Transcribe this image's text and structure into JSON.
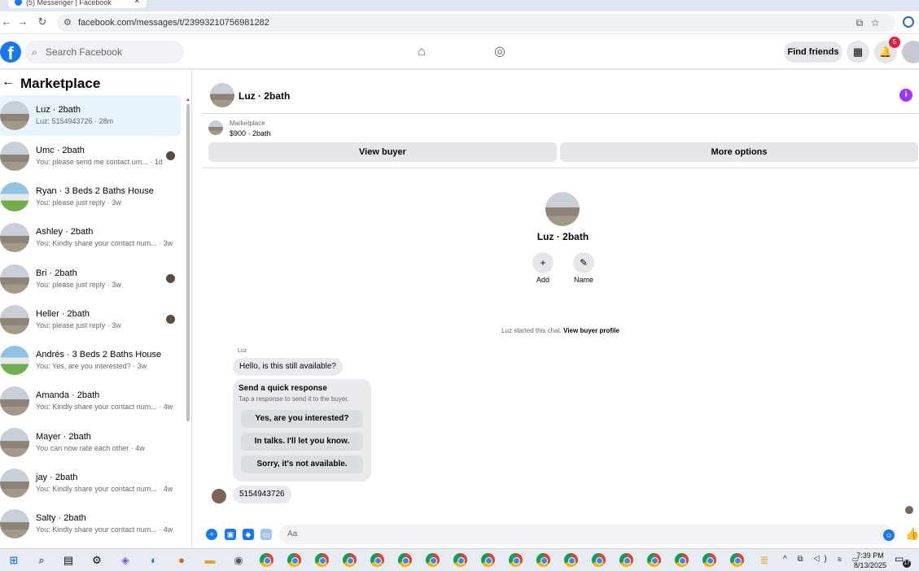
{
  "browser": {
    "tab_title": "(5) Messenger | Facebook",
    "url": "facebook.com/messages/t/23993210756981282"
  },
  "fb_header": {
    "search_placeholder": "Search Facebook",
    "find_friends": "Find friends",
    "notification_count": "5"
  },
  "sidebar": {
    "back_icon": "arrow-left-icon",
    "title": "Marketplace",
    "conversations": [
      {
        "name": "Luz · 2bath",
        "snippet": "Luz: 5154943726 · 28m"
      },
      {
        "name": "Umc · 2bath",
        "snippet": "You: please send me contact um... · 1d"
      },
      {
        "name": "Ryan · 3 Beds 2 Baths House",
        "snippet": "You: please just reply · 3w"
      },
      {
        "name": "Ashley · 2bath",
        "snippet": "You: Kindly share your contact num... · 3w"
      },
      {
        "name": "Bri · 2bath",
        "snippet": "You: please just reply · 3w"
      },
      {
        "name": "Heller · 2bath",
        "snippet": "You: please just reply · 3w"
      },
      {
        "name": "Andrés · 3 Beds 2 Baths House",
        "snippet": "You: Yes, are you interested? · 3w"
      },
      {
        "name": "Amanda · 2bath",
        "snippet": "You: Kindly share your contact num... · 4w"
      },
      {
        "name": "Mayer · 2bath",
        "snippet": "You can now rate each other · 4w"
      },
      {
        "name": "jay · 2bath",
        "snippet": "You: Kindly share your contact num... · 4w"
      },
      {
        "name": "Salty · 2bath",
        "snippet": "You: Kindly share your contact num... · 4w"
      }
    ]
  },
  "chat": {
    "header_name": "Luz · 2bath",
    "marketplace_label": "Marketplace",
    "listing": "$900 · 2bath",
    "view_buyer": "View buyer",
    "more_options": "More options",
    "card_name": "Luz · 2bath",
    "add_label": "Add",
    "name_label": "Name",
    "started_text": "Luz started this chat.",
    "view_buyer_profile": "View buyer profile",
    "sender_label": "Luz",
    "msg_available": "Hello, is this still available?",
    "quick_title": "Send a quick response",
    "quick_sub": "Tap a response to send it to the buyer.",
    "quick_replies": [
      "Yes, are you interested?",
      "In talks. I'll let you know.",
      "Sorry, it's not available."
    ],
    "msg_phone": "5154943726",
    "composer_placeholder": "Aa"
  },
  "taskbar": {
    "time": "7:39 PM",
    "date": "8/13/2025",
    "notif_count": "17"
  },
  "colors": {
    "facebook_blue": "#1877f2",
    "active_row": "#e7f3ff",
    "info_purple": "#a033ff",
    "badge_red": "#e41e3f"
  }
}
